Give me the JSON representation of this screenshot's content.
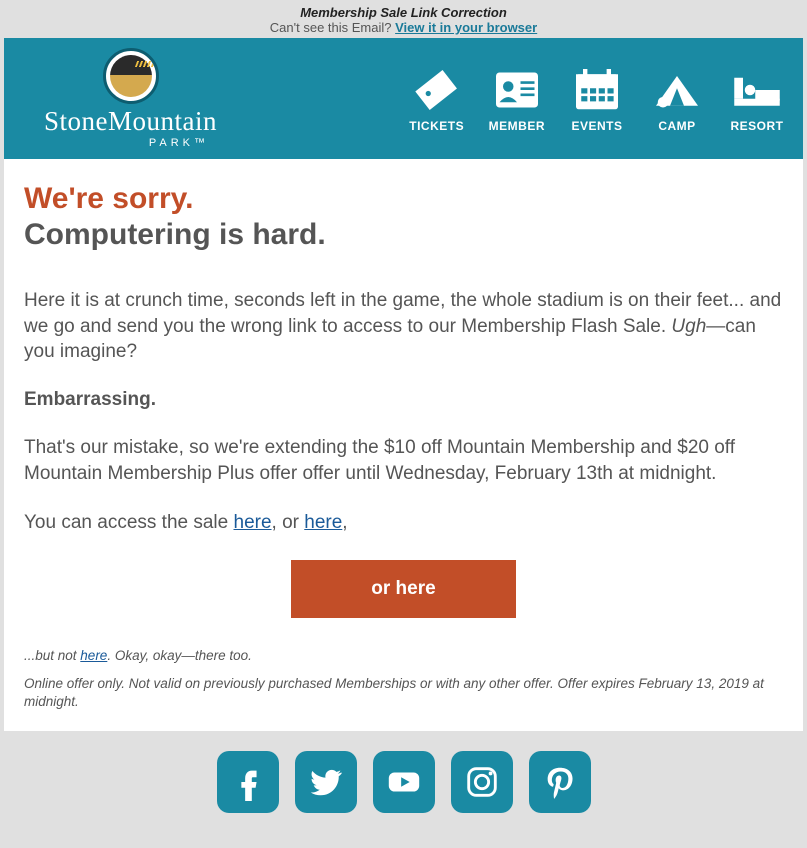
{
  "preheader": {
    "title": "Membership Sale Link Correction",
    "sub": "Can't see this Email? ",
    "link": "View it in your browser"
  },
  "brand": {
    "line1": "StoneMountain",
    "line2": "PARK™"
  },
  "nav": [
    {
      "label": "TICKETS"
    },
    {
      "label": "MEMBER"
    },
    {
      "label": "EVENTS"
    },
    {
      "label": "CAMP"
    },
    {
      "label": "RESORT"
    }
  ],
  "heading": {
    "line1": "We're sorry.",
    "line2": "Computering is hard."
  },
  "para1_a": "Here it is at crunch time, seconds left in the game, the whole stadium is on their feet... and we go and send you the wrong link to access to our Membership Flash Sale. ",
  "para1_ugh": "Ugh",
  "para1_b": "—can you imagine?",
  "embarrassing": "Embarrassing.",
  "para2": "That's our mistake, so we're extending the $10 off Mountain Membership and $20 off Mountain Membership Plus offer offer until Wednesday, February 13th at midnight.",
  "para3_a": "You can access the sale ",
  "para3_link1": "here",
  "para3_b": ", or ",
  "para3_link2": "here",
  "para3_c": ",",
  "cta": "or here",
  "fine_a": "...but not ",
  "fine_link": "here",
  "fine_b": ". Okay, okay—there too.",
  "disclaimer": "Online offer only. Not valid on previously purchased Memberships or with any other offer.  Offer expires February 13, 2019 at midnight.",
  "social": [
    "facebook",
    "twitter",
    "youtube",
    "instagram",
    "pinterest"
  ]
}
